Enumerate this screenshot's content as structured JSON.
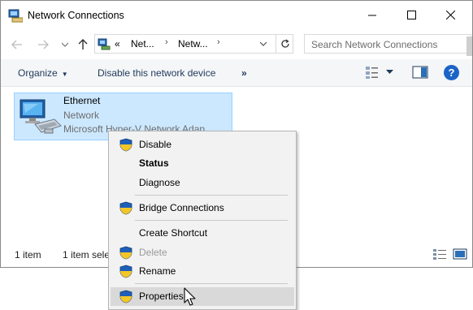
{
  "window": {
    "title": "Network Connections"
  },
  "address": {
    "crumbs": [
      "Net...",
      "Netw..."
    ],
    "overflow": "«",
    "search_placeholder": "Search Network Connections"
  },
  "toolbar": {
    "organize": "Organize",
    "disable": "Disable this network device",
    "more": "»"
  },
  "item": {
    "name": "Ethernet",
    "line2": "Network",
    "line3": "Microsoft Hyper-V Network Adap..."
  },
  "status": {
    "count": "1 item",
    "selected": "1 item sele"
  },
  "context_menu": {
    "items": [
      {
        "label": "Disable",
        "shield": true,
        "bold": false,
        "disabled": false
      },
      {
        "label": "Status",
        "shield": false,
        "bold": true,
        "disabled": false
      },
      {
        "label": "Diagnose",
        "shield": false,
        "bold": false,
        "disabled": false
      },
      {
        "label": "Bridge Connections",
        "shield": true,
        "bold": false,
        "disabled": false
      },
      {
        "label": "Create Shortcut",
        "shield": false,
        "bold": false,
        "disabled": false
      },
      {
        "label": "Delete",
        "shield": true,
        "bold": false,
        "disabled": true
      },
      {
        "label": "Rename",
        "shield": true,
        "bold": false,
        "disabled": false
      },
      {
        "label": "Properties",
        "shield": true,
        "bold": false,
        "disabled": false,
        "hovered": true
      }
    ]
  },
  "colors": {
    "selection_fill": "#cce8ff",
    "selection_border": "#99d1ff",
    "menu_bg": "#f2f2f2",
    "menu_hover": "#d9d9d9",
    "help_blue": "#1c63c7"
  }
}
